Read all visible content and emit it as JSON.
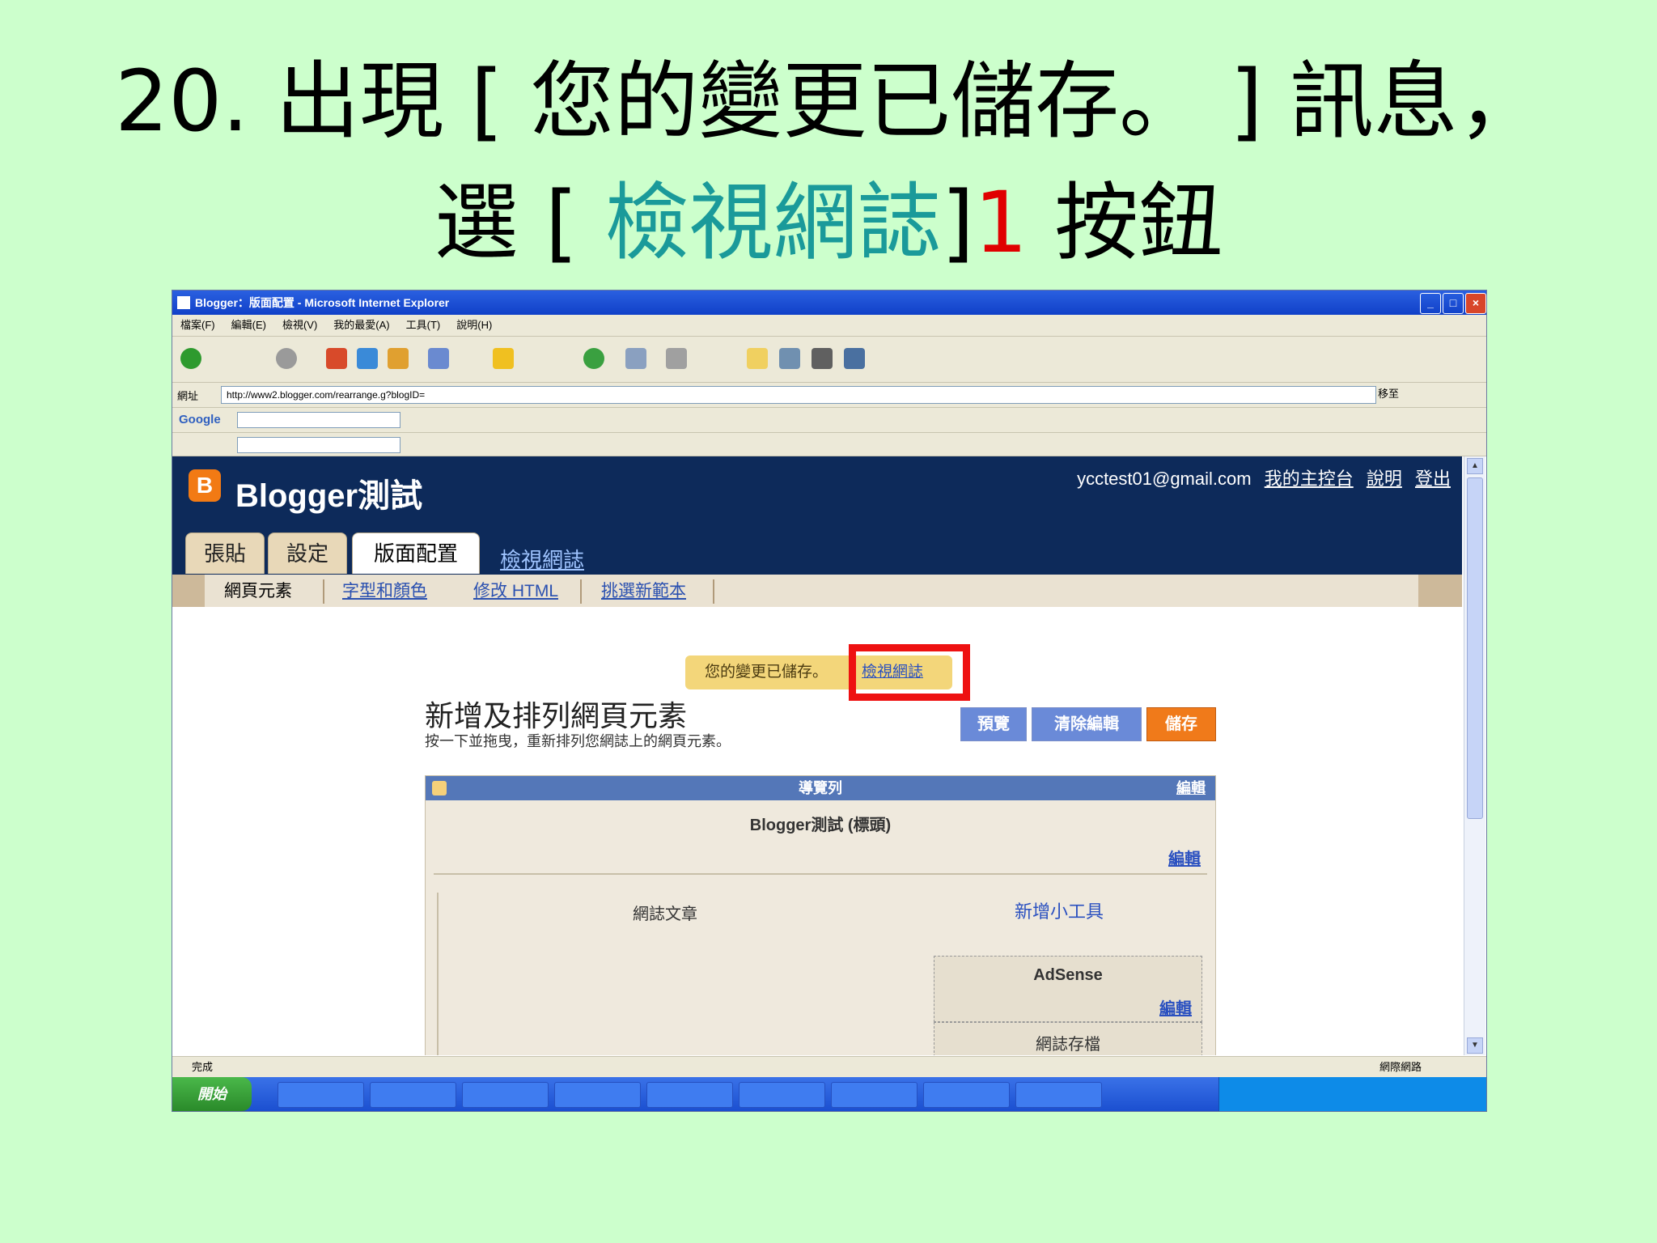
{
  "slide": {
    "line1": "20. 出現 [ 您的變更已儲存。 ] 訊息，",
    "line2_prefix": "選  [ ",
    "line2_link": "檢視網誌",
    "line2_bracket": "]",
    "line2_number": "1",
    "line2_suffix": " 按鈕"
  },
  "browser": {
    "window_title": "Blogger：版面配置 - Microsoft Internet Explorer",
    "menu": [
      "檔案(F)",
      "編輯(E)",
      "檢視(V)",
      "我的最愛(A)",
      "工具(T)",
      "說明(H)"
    ],
    "address_label": "網址",
    "address_value": "http://www2.blogger.com/rearrange.g?blogID=",
    "go_label": "移至",
    "google_label": "Google"
  },
  "blogger": {
    "logo_letter": "B",
    "blog_title": "Blogger測試",
    "account_email": "ycctest01@gmail.com",
    "account_links": [
      "我的主控台",
      "說明",
      "登出"
    ],
    "tabs": [
      "張貼",
      "設定",
      "版面配置"
    ],
    "view_blog_tab": "檢視網誌",
    "subnav": {
      "current": "網頁元素",
      "fonts_colors": "字型和顏色",
      "edit_html": "修改 HTML",
      "templates": "挑選新範本"
    },
    "notice": {
      "message": "您的變更已儲存。",
      "view_link": "檢視網誌"
    },
    "callout_number": "1",
    "page_title": "新增及排列網頁元素",
    "page_subtitle": "按一下並拖曳，重新排列您網誌上的網頁元素。",
    "actions": {
      "preview": "預覽",
      "clear": "清除編輯",
      "save": "儲存"
    },
    "layout": {
      "navbar": "導覽列",
      "navbar_edit": "編輯",
      "header": "Blogger測試 (標頭)",
      "header_edit": "編輯",
      "posts": "網誌文章",
      "add_gadget": "新增小工具",
      "adsense": "AdSense",
      "adsense_edit": "編輯",
      "archive": "網誌存檔"
    }
  },
  "status": {
    "text": "完成",
    "zone": "網際網路"
  },
  "taskbar": {
    "start": "開始"
  },
  "colors": {
    "slide_bg": "#ccffcc",
    "title_link": "#1a9a9a",
    "title_number": "#e00000",
    "blogger_header": "#0d2a5a",
    "callout_box": "#ee1111"
  }
}
